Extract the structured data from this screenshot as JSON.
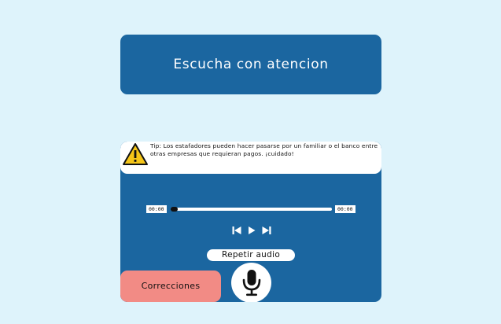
{
  "header": {
    "title": "Escucha con atencion"
  },
  "tip": {
    "icon": "warning-icon",
    "text": "Tip: Los estafadores pueden hacer pasarse por un familiar o el banco entre otras empresas que requieran pagos. ¡cuidado!"
  },
  "player": {
    "current_time": "00:00",
    "total_time": "00:00",
    "progress": 0,
    "controls": {
      "previous": "skip-back-icon",
      "play": "play-icon",
      "next": "skip-forward-icon"
    },
    "repeat_label": "Repetir audio"
  },
  "actions": {
    "corrections_label": "Correcciones",
    "mic_icon": "microphone-icon"
  },
  "colors": {
    "background": "#def3fb",
    "panel": "#1b66a0",
    "corrections": "#f28b85",
    "warning": "#f5c518"
  }
}
